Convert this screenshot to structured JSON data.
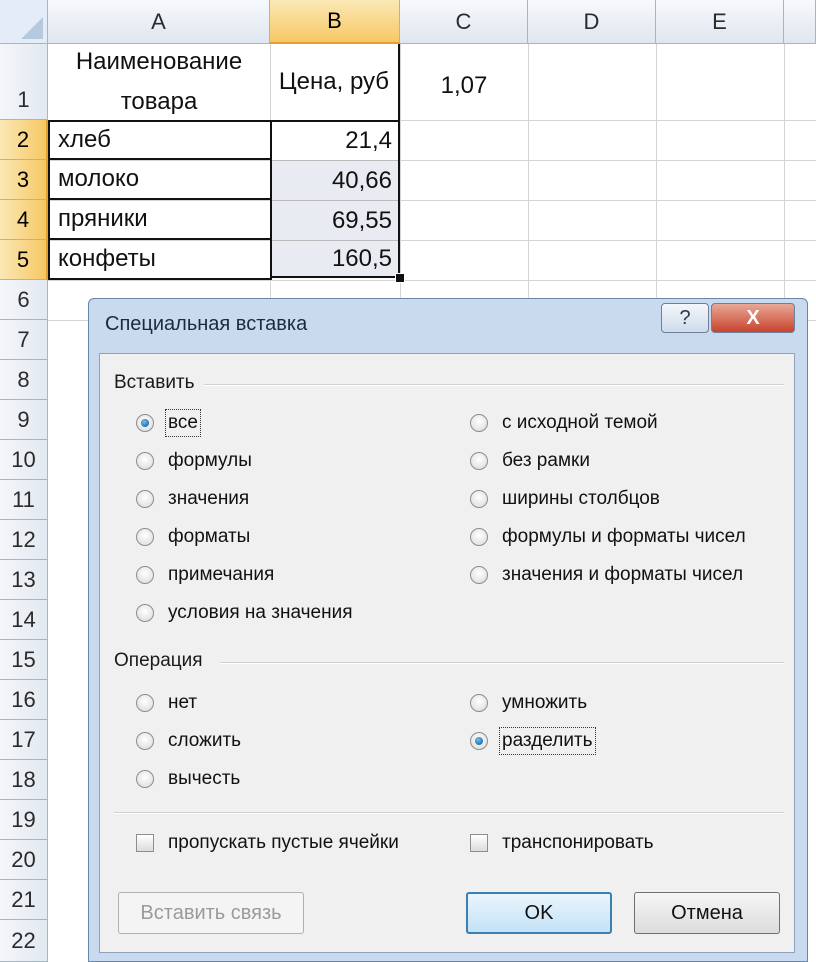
{
  "sheet": {
    "columns": [
      "A",
      "B",
      "C",
      "D",
      "E"
    ],
    "rows": [
      "1",
      "2",
      "3",
      "4",
      "5",
      "6",
      "7",
      "8",
      "9",
      "10",
      "11",
      "12",
      "13",
      "14",
      "15",
      "16",
      "17",
      "18",
      "19",
      "20",
      "21",
      "22"
    ],
    "header_name": "Наименование товара",
    "header_price": "Цена, руб",
    "factor": "1,07",
    "items": [
      {
        "name": "хлеб",
        "price": "21,4"
      },
      {
        "name": "молоко",
        "price": "40,66"
      },
      {
        "name": "пряники",
        "price": "69,55"
      },
      {
        "name": "конфеты",
        "price": "160,5"
      }
    ]
  },
  "dialog": {
    "title": "Специальная вставка",
    "help_label": "?",
    "close_label": "X",
    "paste_group": "Вставить",
    "paste_left": [
      "все",
      "формулы",
      "значения",
      "форматы",
      "примечания",
      "условия на значения"
    ],
    "paste_right": [
      "с исходной темой",
      "без рамки",
      "ширины столбцов",
      "формулы и форматы чисел",
      "значения и форматы чисел"
    ],
    "operation_group": "Операция",
    "op_left": [
      "нет",
      "сложить",
      "вычесть"
    ],
    "op_right": [
      "умножить",
      "разделить"
    ],
    "skip_blanks": "пропускать пустые ячейки",
    "transpose": "транспонировать",
    "paste_link": "Вставить связь",
    "ok": "OK",
    "cancel": "Отмена"
  }
}
